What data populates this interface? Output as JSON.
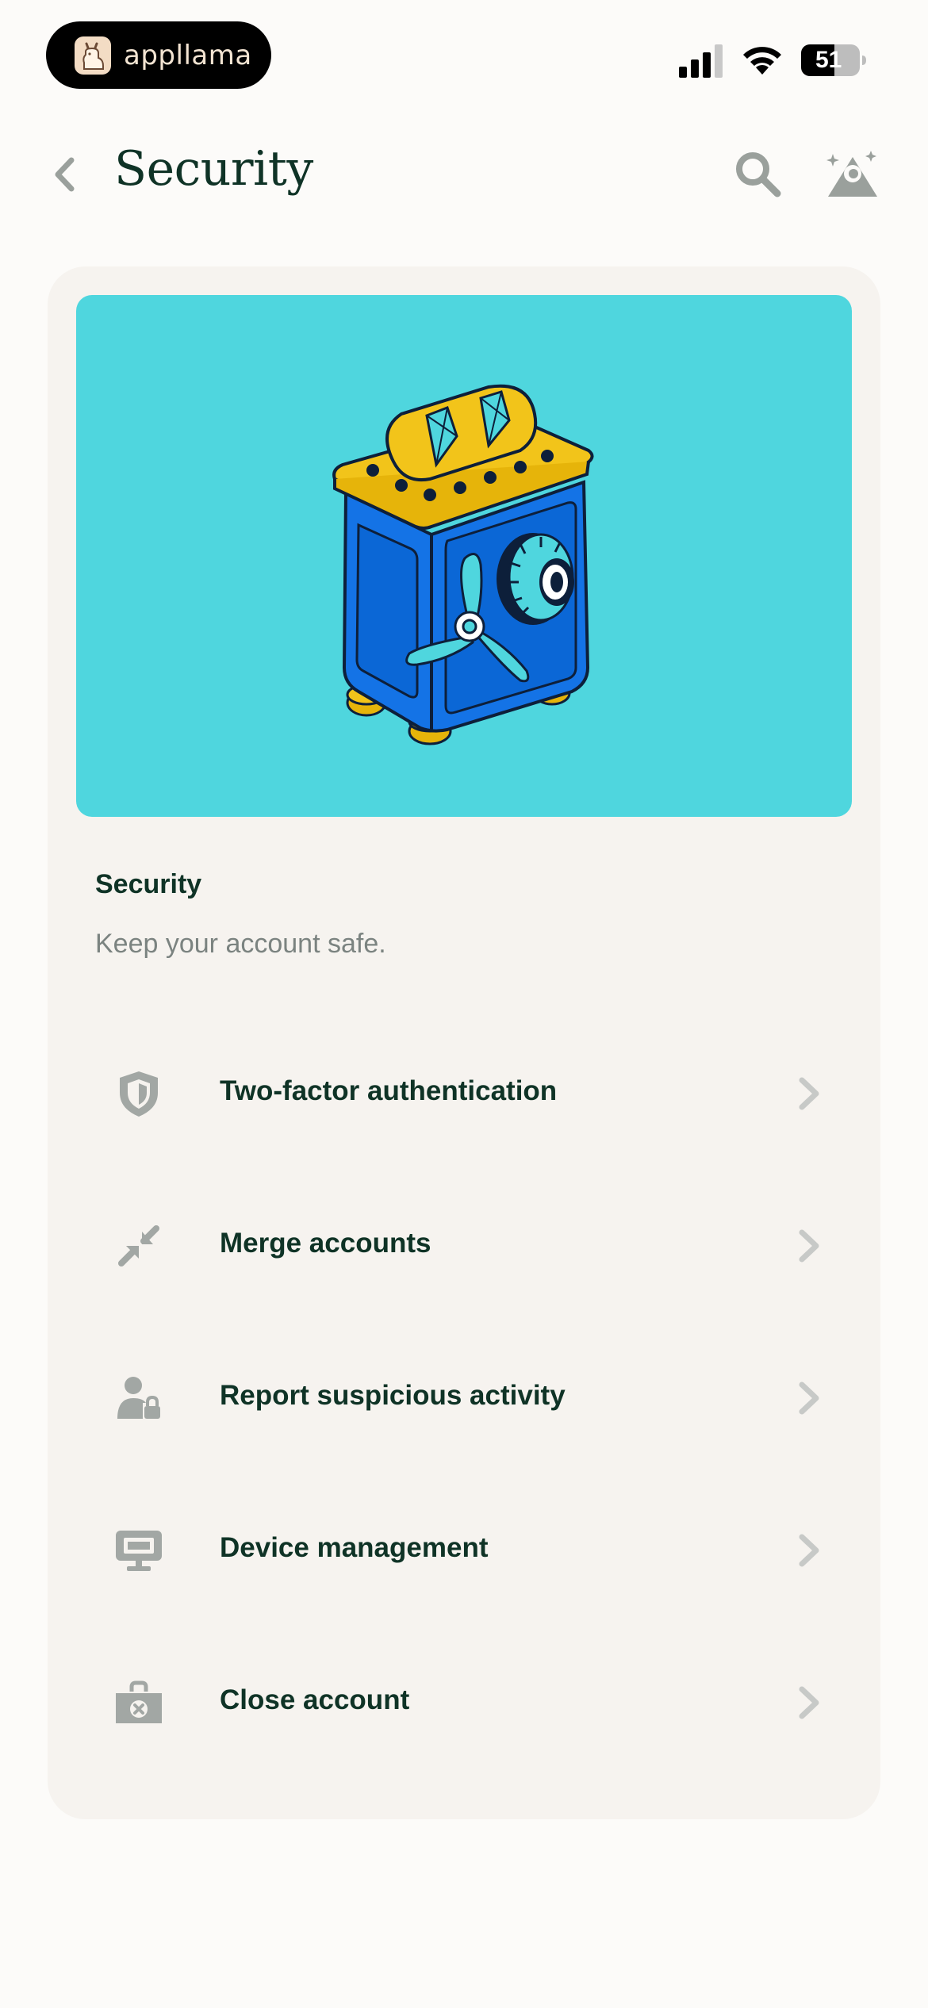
{
  "status_bar": {
    "app_name": "appllama",
    "battery_level": "51"
  },
  "header": {
    "title": "Security"
  },
  "section": {
    "heading": "Security",
    "subtitle": "Keep your account safe."
  },
  "menu": [
    {
      "label": "Two-factor authentication",
      "icon": "shield-icon"
    },
    {
      "label": "Merge accounts",
      "icon": "merge-arrows-icon"
    },
    {
      "label": "Report suspicious activity",
      "icon": "user-lock-icon"
    },
    {
      "label": "Device management",
      "icon": "monitor-icon"
    },
    {
      "label": "Close account",
      "icon": "briefcase-x-icon"
    }
  ],
  "colors": {
    "background": "#fcfbf9",
    "card": "#f6f3ef",
    "hero": "#4fd6de",
    "text": "#0f3326",
    "icon_gray": "#a2a7a4"
  }
}
